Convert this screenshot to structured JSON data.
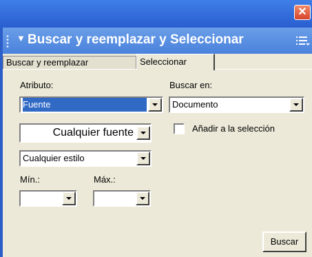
{
  "window": {
    "close_glyph": "✕"
  },
  "panel": {
    "title": "Buscar y reemplazar y Seleccionar",
    "collapse_glyph": "▼"
  },
  "tabs": [
    {
      "label": "Buscar y reemplazar"
    },
    {
      "label": "Seleccionar"
    }
  ],
  "active_tab": 1,
  "attribute": {
    "label": "Atributo:",
    "value": "Fuente"
  },
  "search_in": {
    "label": "Buscar en:",
    "value": "Documento"
  },
  "font": {
    "value": "Cualquier fuente"
  },
  "style": {
    "value": "Cualquier estilo"
  },
  "add_to_selection": {
    "label": "Añadir a la selección",
    "checked": false
  },
  "min": {
    "label": "Mín.:",
    "value": ""
  },
  "max": {
    "label": "Máx.:",
    "value": ""
  },
  "search_button": {
    "label": "Buscar"
  },
  "colors": {
    "titlebar": "#2a5ed0",
    "panel_header": "#4a82dc",
    "selection": "#316ac5",
    "background": "#ece9d8"
  },
  "icons": [
    "close-icon",
    "gripper-icon",
    "collapse-arrow-icon",
    "panel-menu-icon",
    "dropdown-arrow-icon"
  ]
}
